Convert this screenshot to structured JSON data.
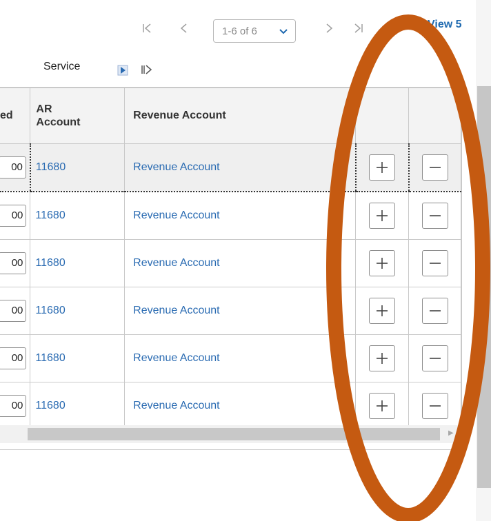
{
  "pager": {
    "first_icon": "first-page-icon",
    "prev_icon": "previous-page-icon",
    "range_select": "1-6 of 6",
    "next_icon": "next-page-icon",
    "last_icon": "last-page-icon",
    "view_link": "View 5"
  },
  "tabs": {
    "service_label": "Service",
    "next_tab_icon": "next-tab-icon",
    "show_all_icon": "show-all-columns-icon"
  },
  "grid": {
    "columns": [
      "ed",
      "AR Account",
      "Revenue Account",
      "",
      ""
    ],
    "columns_display": {
      "ed": "ed",
      "ar_line1": "AR",
      "ar_line2": "Account",
      "revenue": "Revenue Account"
    },
    "rows": [
      {
        "amount": "00",
        "ar_account": "11680",
        "revenue_account": "Revenue Account",
        "selected": true
      },
      {
        "amount": "00",
        "ar_account": "11680",
        "revenue_account": "Revenue Account",
        "selected": false
      },
      {
        "amount": "00",
        "ar_account": "11680",
        "revenue_account": "Revenue Account",
        "selected": false
      },
      {
        "amount": "00",
        "ar_account": "11680",
        "revenue_account": "Revenue Account",
        "selected": false
      },
      {
        "amount": "00",
        "ar_account": "11680",
        "revenue_account": "Revenue Account",
        "selected": false
      },
      {
        "amount": "00",
        "ar_account": "11680",
        "revenue_account": "Revenue Account",
        "selected": false
      }
    ],
    "add_row_icon": "plus-icon",
    "delete_row_icon": "minus-icon"
  },
  "colors": {
    "link": "#2a6bb2",
    "annotation": "#c55a11",
    "header_bg": "#f3f3f3"
  }
}
